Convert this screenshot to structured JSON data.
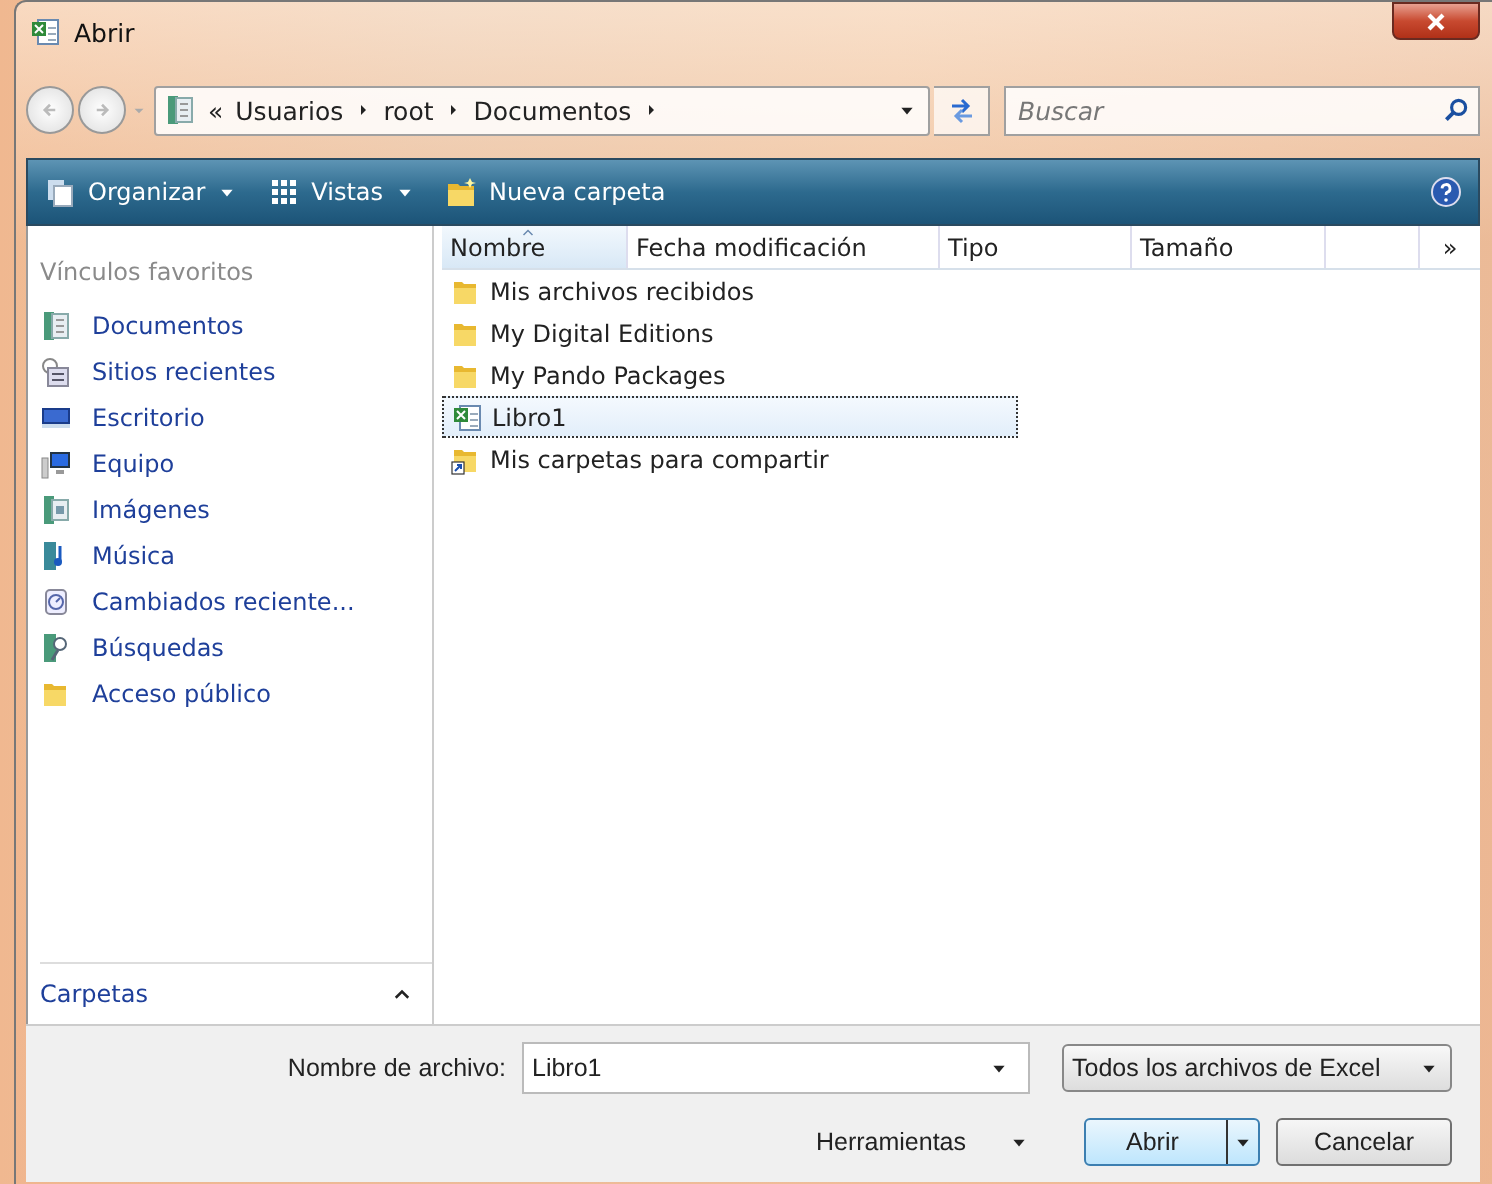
{
  "window": {
    "title": "Abrir"
  },
  "address": {
    "overflow": "«",
    "crumbs": [
      "Usuarios",
      "root",
      "Documentos"
    ]
  },
  "search": {
    "placeholder": "Buscar"
  },
  "toolbar": [
    {
      "label": "Organizar",
      "kind": "organize"
    },
    {
      "label": "Vistas",
      "kind": "views"
    },
    {
      "label": "Nueva carpeta",
      "kind": "newfolder"
    }
  ],
  "sidebar": {
    "heading": "Vínculos favoritos",
    "items": [
      {
        "label": "Documentos",
        "kind": "documents"
      },
      {
        "label": "Sitios recientes",
        "kind": "recent"
      },
      {
        "label": "Escritorio",
        "kind": "desktop"
      },
      {
        "label": "Equipo",
        "kind": "computer"
      },
      {
        "label": "Imágenes",
        "kind": "pictures"
      },
      {
        "label": "Música",
        "kind": "music"
      },
      {
        "label": "Cambiados reciente...",
        "kind": "changed"
      },
      {
        "label": "Búsquedas",
        "kind": "searches"
      },
      {
        "label": "Acceso público",
        "kind": "folder"
      }
    ],
    "footer": "Carpetas",
    "footer_expanded": true
  },
  "table": {
    "columns": [
      {
        "label": "Nombre",
        "sorted": true
      },
      {
        "label": "Fecha modificación",
        "sorted": false
      },
      {
        "label": "Tipo",
        "sorted": false
      },
      {
        "label": "Tamaño",
        "sorted": false
      }
    ],
    "more": "»",
    "rows": [
      {
        "name": "Mis archivos recibidos",
        "kind": "folder",
        "selected": false
      },
      {
        "name": "My Digital Editions",
        "kind": "folder",
        "selected": false
      },
      {
        "name": "My Pando Packages",
        "kind": "folder",
        "selected": false
      },
      {
        "name": "Libro1",
        "kind": "excel",
        "selected": true
      },
      {
        "name": "Mis carpetas para compartir",
        "kind": "shortcut",
        "selected": false
      }
    ]
  },
  "filename": {
    "label": "Nombre de archivo:",
    "value": "Libro1"
  },
  "filetype": {
    "value": "Todos los archivos de Excel"
  },
  "tools": "Herramientas",
  "buttons": [
    {
      "label": "Abrir",
      "kind": "split",
      "default": true
    },
    {
      "label": "Cancelar",
      "kind": "plain",
      "default": false
    }
  ]
}
